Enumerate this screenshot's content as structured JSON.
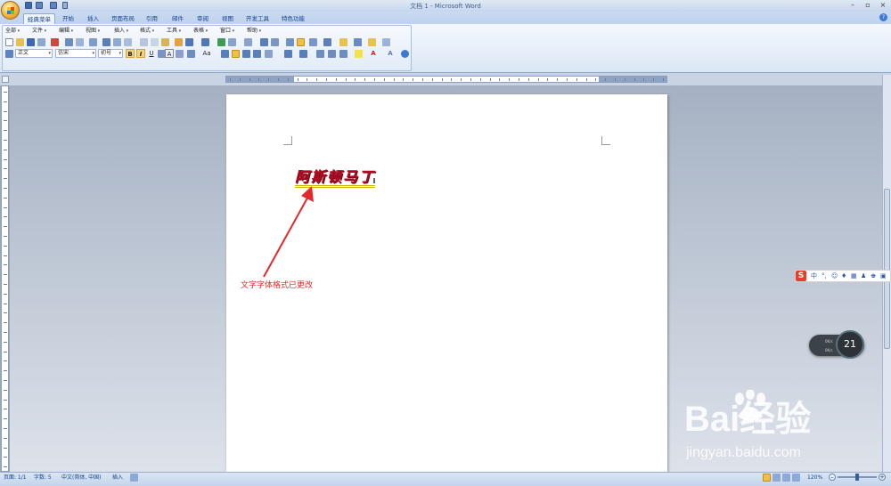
{
  "window": {
    "title": "文档 1 - Microsoft Word"
  },
  "tabs": [
    "经典菜单",
    "开始",
    "插入",
    "页面布局",
    "引用",
    "邮件",
    "审阅",
    "视图",
    "开发工具",
    "特色功能"
  ],
  "menu": [
    "全部",
    "文件",
    "编辑",
    "视图",
    "插入",
    "格式",
    "工具",
    "表格",
    "窗口",
    "帮助"
  ],
  "toolbar": {
    "style": "正文",
    "font": "仿宋",
    "size": "初号",
    "bold": "B",
    "italic": "I",
    "underline": "U",
    "char_a": "A",
    "font_size_btn": "Aa"
  },
  "document": {
    "word": "阿斯顿马丁"
  },
  "annotation": "文字字体格式已更改",
  "status": {
    "page": "页面: 1/1",
    "words": "字数: 5",
    "lang": "中文(简体, 中国)",
    "mode": "插入",
    "zoom": "120%"
  },
  "ime": {
    "mode": "中"
  },
  "net": {
    "up": "0K/s",
    "down": "0K/s",
    "gauge": "21"
  },
  "watermark": {
    "brand": "Bai经验",
    "url": "jingyan.baidu.com"
  },
  "colors": {
    "accent": "#15428b",
    "annotation": "#e2292b",
    "docText": "#b40a24",
    "underline": "#c9b700"
  }
}
